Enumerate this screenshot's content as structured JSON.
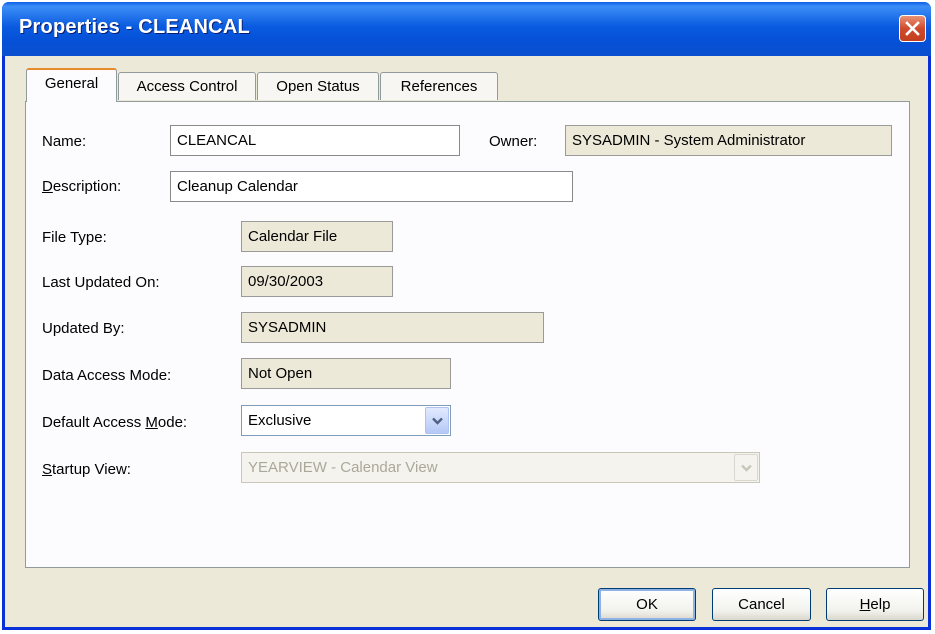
{
  "window": {
    "title": "Properties - CLEANCAL"
  },
  "tabs": [
    {
      "label": "General",
      "active": true
    },
    {
      "label": "Access Control",
      "active": false
    },
    {
      "label": "Open Status",
      "active": false
    },
    {
      "label": "References",
      "active": false
    }
  ],
  "form": {
    "name_label": "Name:",
    "name_value": "CLEANCAL",
    "owner_label": "Owner:",
    "owner_value": "SYSADMIN - System Administrator",
    "description_label": "Description:",
    "description_value": "Cleanup Calendar",
    "file_type_label": "File Type:",
    "file_type_value": "Calendar File",
    "last_updated_label": "Last Updated On:",
    "last_updated_value": "09/30/2003",
    "updated_by_label": "Updated By:",
    "updated_by_value": "SYSADMIN",
    "data_access_label": "Data Access Mode:",
    "data_access_value": "Not Open",
    "default_access_label_pre": "Default Access ",
    "default_access_label_u": "M",
    "default_access_label_post": "ode:",
    "default_access_value": "Exclusive",
    "startup_view_label_u": "S",
    "startup_view_label_post": "tartup View:",
    "startup_view_value": "YEARVIEW - Calendar View"
  },
  "buttons": {
    "ok": "OK",
    "cancel": "Cancel",
    "help_u": "H",
    "help_post": "elp"
  },
  "colors": {
    "titlebar": "#0a5be0",
    "dialog_bg": "#ece9d8",
    "active_tab_accent": "#e68b2c",
    "close_button": "#cf4a2c"
  },
  "icons": {
    "close": "close-icon",
    "dropdown": "chevron-down-icon"
  }
}
